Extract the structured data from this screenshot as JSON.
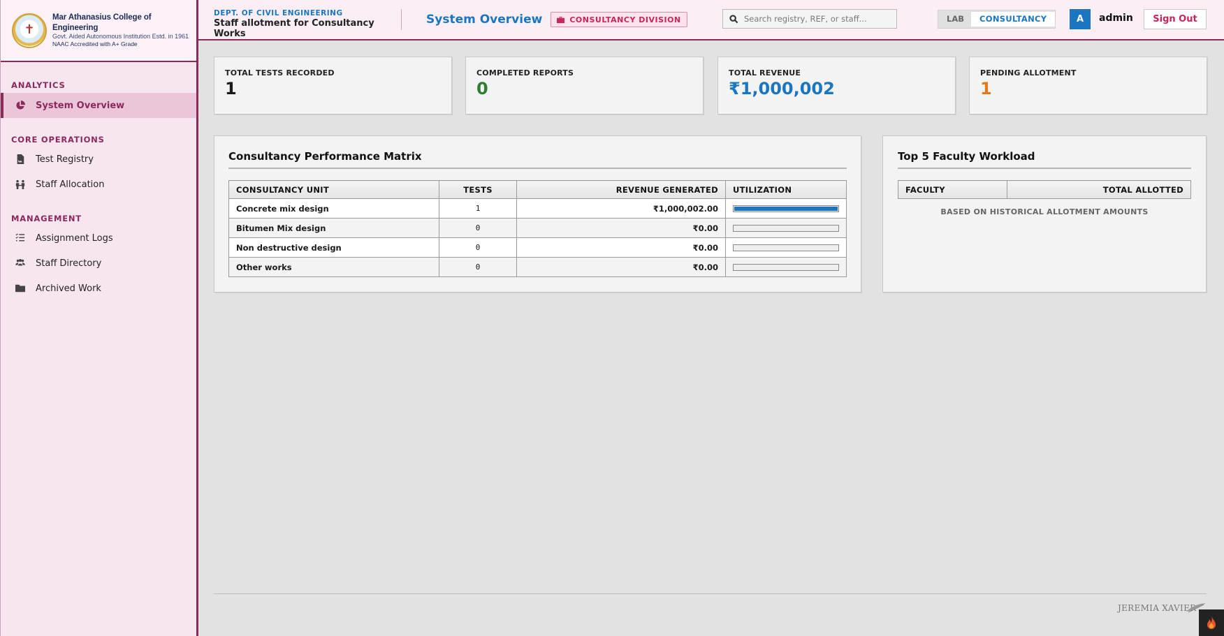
{
  "brand": {
    "name": "Mar Athanasius College of Engineering",
    "subtitle": "Govt. Aided Autonomous Institution Estd. in 1961",
    "accreditation": "NAAC Accredited with A+ Grade"
  },
  "sidebar": {
    "sections": [
      {
        "title": "ANALYTICS",
        "items": [
          {
            "label": "System Overview",
            "icon": "pie-chart-icon",
            "active": true
          }
        ]
      },
      {
        "title": "CORE OPERATIONS",
        "items": [
          {
            "label": "Test Registry",
            "icon": "file-icon"
          },
          {
            "label": "Staff Allocation",
            "icon": "people-icon"
          }
        ]
      },
      {
        "title": "MANAGEMENT",
        "items": [
          {
            "label": "Assignment Logs",
            "icon": "list-icon"
          },
          {
            "label": "Staff Directory",
            "icon": "users-icon"
          },
          {
            "label": "Archived Work",
            "icon": "folder-icon"
          }
        ]
      }
    ]
  },
  "header": {
    "dept": "DEPT. OF CIVIL ENGINEERING",
    "app_title": "Staff allotment for Consultancy Works",
    "page_title": "System Overview",
    "division_badge": "CONSULTANCY DIVISION",
    "search_placeholder": "Search registry, REF, or staff...",
    "modes": [
      "LAB",
      "CONSULTANCY"
    ],
    "active_mode": "CONSULTANCY",
    "avatar_initial": "A",
    "username": "admin",
    "signout_label": "Sign Out"
  },
  "stats": [
    {
      "label": "TOTAL TESTS RECORDED",
      "value": "1",
      "color": "#1a1a1a"
    },
    {
      "label": "COMPLETED REPORTS",
      "value": "0",
      "color": "#2e7d32"
    },
    {
      "label": "TOTAL REVENUE",
      "value": "₹1,000,002",
      "color": "#1b76c2"
    },
    {
      "label": "PENDING ALLOTMENT",
      "value": "1",
      "color": "#e07b1a"
    }
  ],
  "performance": {
    "title": "Consultancy Performance Matrix",
    "columns": [
      "CONSULTANCY UNIT",
      "TESTS",
      "REVENUE GENERATED",
      "UTILIZATION"
    ],
    "rows": [
      {
        "unit": "Concrete mix design",
        "tests": "1",
        "revenue": "₹1,000,002.00",
        "utilization": 1.0
      },
      {
        "unit": "Bitumen Mix design",
        "tests": "0",
        "revenue": "₹0.00",
        "utilization": 0
      },
      {
        "unit": "Non destructive design",
        "tests": "0",
        "revenue": "₹0.00",
        "utilization": 0
      },
      {
        "unit": "Other works",
        "tests": "0",
        "revenue": "₹0.00",
        "utilization": 0
      }
    ]
  },
  "workload": {
    "title": "Top 5 Faculty Workload",
    "columns": [
      "FACULTY",
      "TOTAL ALLOTTED"
    ],
    "note": "BASED ON HISTORICAL ALLOTMENT AMOUNTS"
  },
  "footer": {
    "signature": "JEREMIA XAVIER"
  },
  "colors": {
    "accent": "#8a2a5a",
    "primary": "#1b76c2",
    "danger": "#c8265a"
  }
}
